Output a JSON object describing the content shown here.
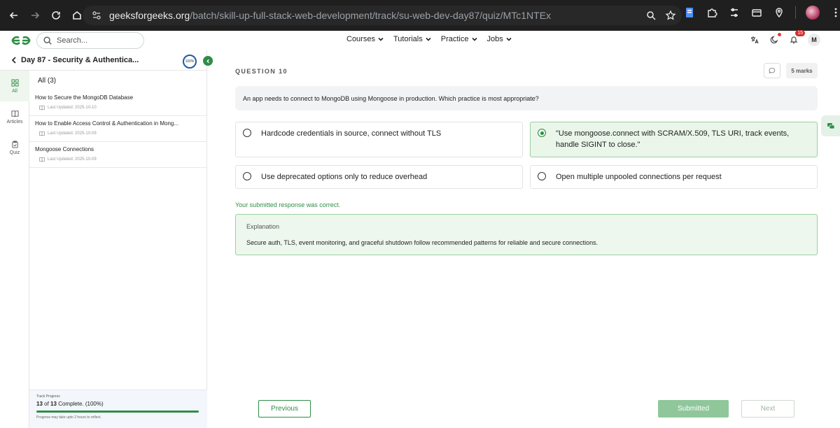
{
  "browser": {
    "url_host": "geeksforgeeks.org",
    "url_path": "/batch/skill-up-full-stack-web-development/track/su-web-dev-day87/quiz/MTc1NTEx"
  },
  "header": {
    "search_placeholder": "Search...",
    "nav": [
      "Courses",
      "Tutorials",
      "Practice",
      "Jobs"
    ],
    "notification_count": "15",
    "user_initial": "M"
  },
  "sidebar": {
    "title": "Day 87 - Security & Authentica...",
    "progress_ring": "100%",
    "rail": [
      {
        "label": "All",
        "active": true
      },
      {
        "label": "Articles",
        "active": false
      },
      {
        "label": "Quiz",
        "active": false
      }
    ],
    "list_heading": "All (3)",
    "items": [
      {
        "title": "How to Secure the MongoDB Database",
        "meta": "Last Updated: 2025-10-10"
      },
      {
        "title": "How to Enable Access Control & Authentication in Mong...",
        "meta": "Last Updated: 2025-10-09"
      },
      {
        "title": "Mongoose Connections",
        "meta": "Last Updated: 2025-10-09"
      }
    ],
    "track": {
      "label": "Track Progress",
      "count_bold": "13",
      "count_rest": "of",
      "count_total": "13",
      "count_suffix": "Complete. (100%)",
      "fraction": 1.0,
      "note": "Progress may take upto 2 hours to reflect."
    }
  },
  "question": {
    "label": "QUESTION 10",
    "marks": "5 marks",
    "text": "An app needs to connect to MongoDB using Mongoose in production. Which practice is most appropriate?",
    "options": [
      {
        "text": "Hardcode credentials in source, connect without TLS",
        "selected": false
      },
      {
        "text": "\"Use mongoose.connect with SCRAM/X.509, TLS URI, track events, handle SIGINT to close.\"",
        "selected": true
      },
      {
        "text": "Use deprecated options only to reduce overhead",
        "selected": false
      },
      {
        "text": "Open multiple unpooled connections per request",
        "selected": false
      }
    ],
    "feedback": "Your submitted response was correct.",
    "explanation_title": "Explanation",
    "explanation_text": "Secure auth, TLS, event monitoring, and graceful shutdown follow recommended patterns for reliable and secure connections."
  },
  "footer": {
    "previous": "Previous",
    "submitted": "Submitted",
    "next": "Next"
  },
  "colors": {
    "accent": "#2f8d46",
    "selected_bg": "#eaf6ea",
    "chrome_bg": "#1f1f1f"
  }
}
